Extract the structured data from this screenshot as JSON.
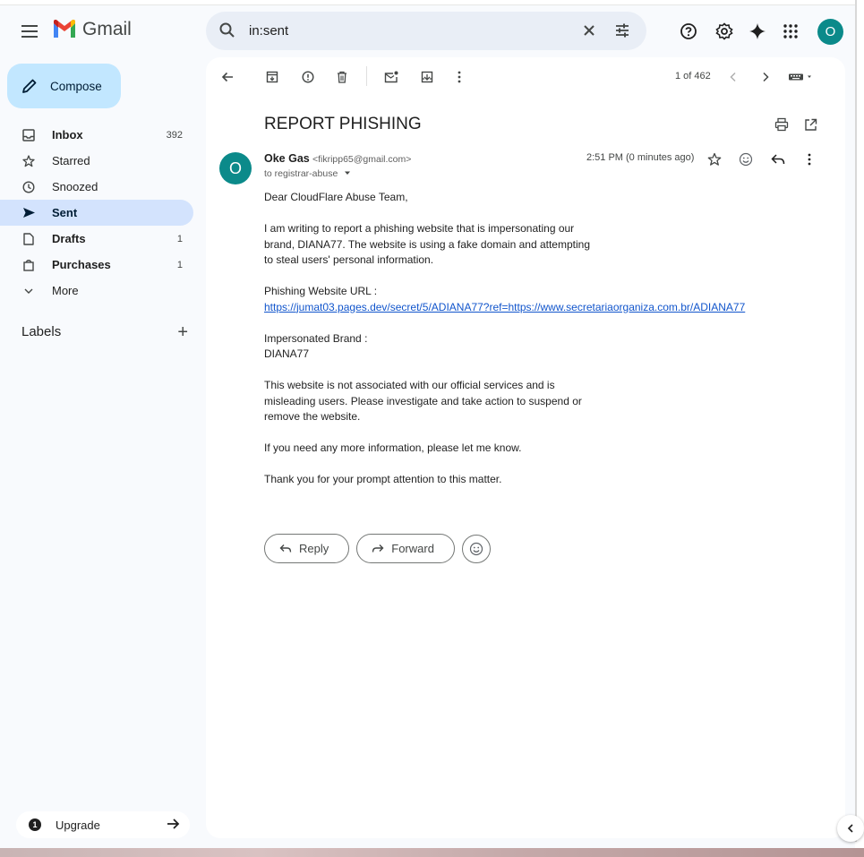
{
  "app": {
    "name": "Gmail"
  },
  "search": {
    "value": "in:sent"
  },
  "user": {
    "avatar_initial": "O"
  },
  "compose": {
    "label": "Compose"
  },
  "sidebar": {
    "items": [
      {
        "label": "Inbox",
        "count": "392",
        "icon": "inbox-icon"
      },
      {
        "label": "Starred",
        "count": "",
        "icon": "star-icon"
      },
      {
        "label": "Snoozed",
        "count": "",
        "icon": "clock-icon"
      },
      {
        "label": "Sent",
        "count": "",
        "icon": "send-icon"
      },
      {
        "label": "Drafts",
        "count": "1",
        "icon": "draft-icon"
      },
      {
        "label": "Purchases",
        "count": "1",
        "icon": "purchases-icon"
      },
      {
        "label": "More",
        "count": "",
        "icon": "chevron-down-icon"
      }
    ],
    "labels_heading": "Labels",
    "upgrade_label": "Upgrade"
  },
  "toolbar": {
    "pager": "1 of 462"
  },
  "message": {
    "subject": "REPORT PHISHING",
    "sender_name": "Oke Gas",
    "sender_email": "<fikripp65@gmail.com>",
    "to": "to registrar-abuse",
    "time": "2:51 PM (0 minutes ago)",
    "sender_initial": "O",
    "greeting": "Dear CloudFlare Abuse Team,",
    "para1": "I am writing to report a phishing website that is impersonating our brand, DIANA77. The website is using a fake domain and attempting to steal users' personal information.",
    "url_label": "Phishing Website URL :",
    "url": "https://jumat03.pages.dev/secret/5/ADIANA77?ref=https://www.secretariaorganiza.com.br/ADIANA77",
    "brand_label": "Impersonated Brand :",
    "brand": "DIANA77",
    "para2": "This website is not associated with our official services and is misleading users. Please investigate and take action to suspend or remove the website.",
    "para3": "If you need any more information, please let me know.",
    "para4": "Thank you for your prompt attention to this matter."
  },
  "actions": {
    "reply_label": "Reply",
    "forward_label": "Forward"
  },
  "colors": {
    "accent": "#0b57d0",
    "compose_bg": "#c2e7ff",
    "active_nav": "#d3e3fd",
    "avatar": "#0b8a8a",
    "link": "#1155cc"
  }
}
